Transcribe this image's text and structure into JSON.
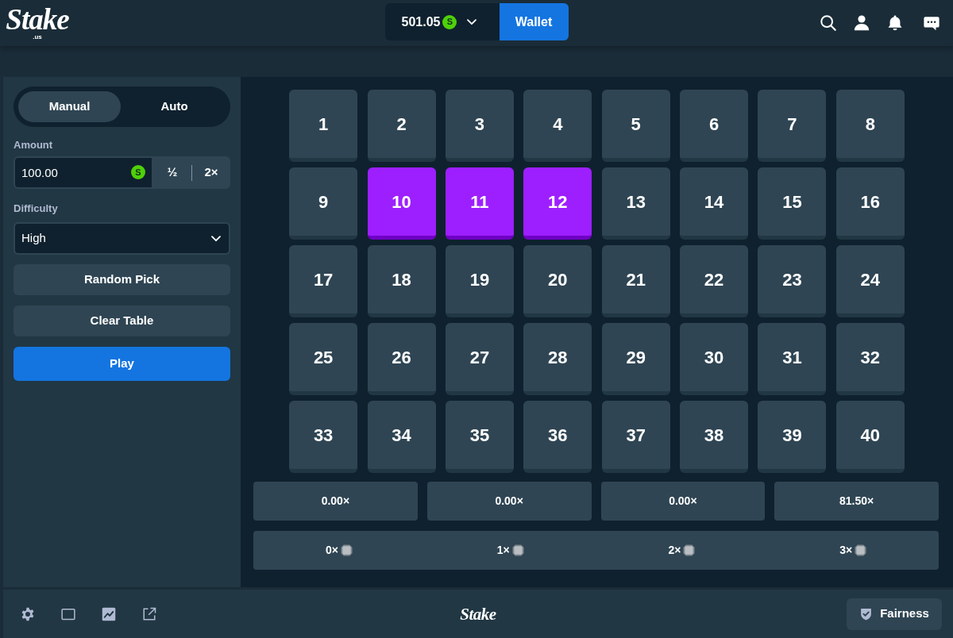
{
  "header": {
    "logo": {
      "wordmark": "Stake",
      "suffix": ".us"
    },
    "balance": {
      "amount": "501.05",
      "currency_symbol": "S"
    },
    "wallet_button": "Wallet"
  },
  "sidebar": {
    "mode_tabs": [
      {
        "label": "Manual",
        "selected": true
      },
      {
        "label": "Auto",
        "selected": false
      }
    ],
    "amount": {
      "label": "Amount",
      "value": "100.00",
      "currency_symbol": "S",
      "buttons": [
        "½",
        "2×"
      ]
    },
    "difficulty": {
      "label": "Difficulty",
      "value": "High"
    },
    "buttons": [
      {
        "label": "Random Pick",
        "kind": "secondary"
      },
      {
        "label": "Clear Table",
        "kind": "secondary"
      },
      {
        "label": "Play",
        "kind": "primary"
      }
    ]
  },
  "board": {
    "tiles": [
      {
        "label": "1",
        "selected": false
      },
      {
        "label": "2",
        "selected": false
      },
      {
        "label": "3",
        "selected": false
      },
      {
        "label": "4",
        "selected": false
      },
      {
        "label": "5",
        "selected": false
      },
      {
        "label": "6",
        "selected": false
      },
      {
        "label": "7",
        "selected": false
      },
      {
        "label": "8",
        "selected": false
      },
      {
        "label": "9",
        "selected": false
      },
      {
        "label": "10",
        "selected": true
      },
      {
        "label": "11",
        "selected": true
      },
      {
        "label": "12",
        "selected": true
      },
      {
        "label": "13",
        "selected": false
      },
      {
        "label": "14",
        "selected": false
      },
      {
        "label": "15",
        "selected": false
      },
      {
        "label": "16",
        "selected": false
      },
      {
        "label": "17",
        "selected": false
      },
      {
        "label": "18",
        "selected": false
      },
      {
        "label": "19",
        "selected": false
      },
      {
        "label": "20",
        "selected": false
      },
      {
        "label": "21",
        "selected": false
      },
      {
        "label": "22",
        "selected": false
      },
      {
        "label": "23",
        "selected": false
      },
      {
        "label": "24",
        "selected": false
      },
      {
        "label": "25",
        "selected": false
      },
      {
        "label": "26",
        "selected": false
      },
      {
        "label": "27",
        "selected": false
      },
      {
        "label": "28",
        "selected": false
      },
      {
        "label": "29",
        "selected": false
      },
      {
        "label": "30",
        "selected": false
      },
      {
        "label": "31",
        "selected": false
      },
      {
        "label": "32",
        "selected": false
      },
      {
        "label": "33",
        "selected": false
      },
      {
        "label": "34",
        "selected": false
      },
      {
        "label": "35",
        "selected": false
      },
      {
        "label": "36",
        "selected": false
      },
      {
        "label": "37",
        "selected": false
      },
      {
        "label": "38",
        "selected": false
      },
      {
        "label": "39",
        "selected": false
      },
      {
        "label": "40",
        "selected": false
      }
    ],
    "payouts": [
      "0.00×",
      "0.00×",
      "0.00×",
      "81.50×"
    ],
    "hits": [
      "0×",
      "1×",
      "2×",
      "3×"
    ]
  },
  "footer": {
    "logo": "Stake",
    "fairness_button": "Fairness"
  }
}
